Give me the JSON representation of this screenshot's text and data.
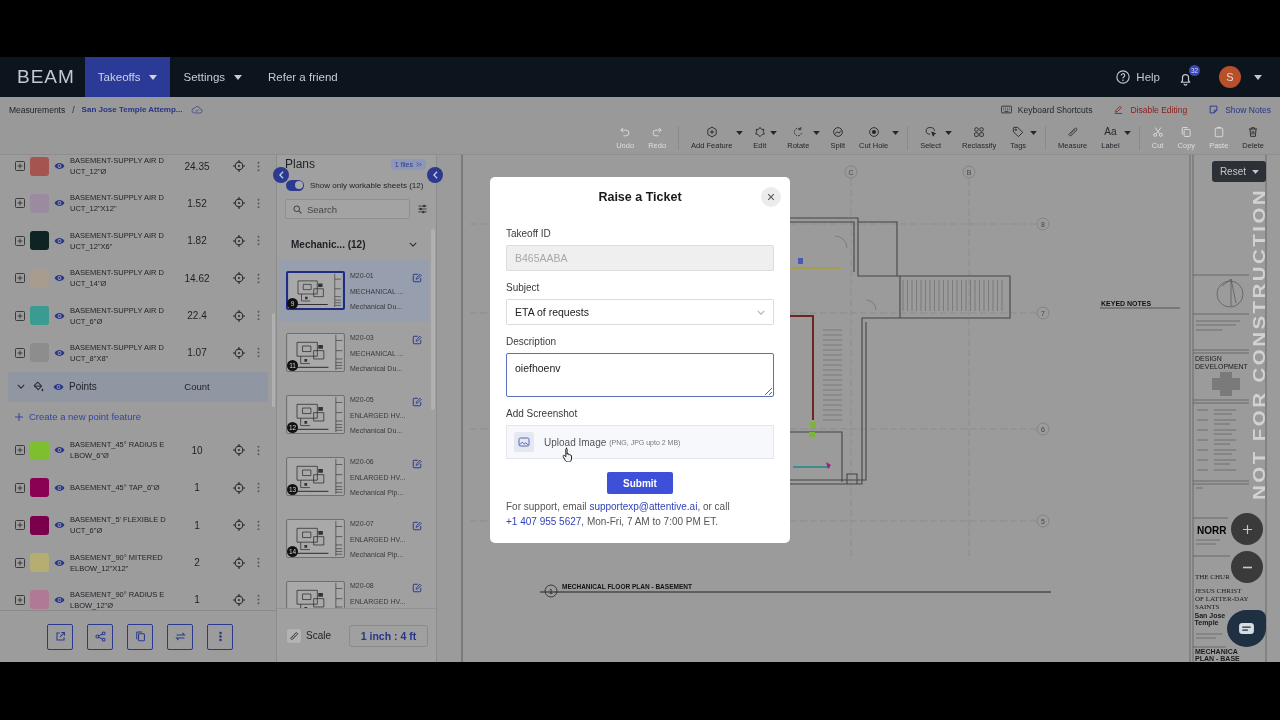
{
  "header": {
    "logo": "BEAM",
    "nav": [
      {
        "label": "Takeoffs",
        "selected": true,
        "menu": true
      },
      {
        "label": "Settings",
        "selected": false,
        "menu": true
      },
      {
        "label": "Refer a friend",
        "selected": false,
        "menu": false
      }
    ],
    "help": "Help",
    "notifications": "32",
    "avatar": "S"
  },
  "breadcrumb": {
    "items": [
      "Measurements",
      "San Jose Temple Attemp..."
    ],
    "separator": "/",
    "actions": [
      {
        "label": "Keyboard Shortcuts",
        "kind": "shortcuts"
      },
      {
        "label": "Disable Editing",
        "kind": "danger"
      },
      {
        "label": "Show Notes",
        "kind": "notes"
      }
    ]
  },
  "toolbar": {
    "groups": [
      {
        "tools": [
          {
            "label": "Undo",
            "disabled": true,
            "menu": false
          },
          {
            "label": "Redo",
            "disabled": true,
            "menu": false
          }
        ]
      },
      {
        "tools": [
          {
            "label": "Add Feature",
            "disabled": false,
            "menu": true
          },
          {
            "label": "Edit",
            "disabled": false,
            "menu": true
          },
          {
            "label": "Rotate",
            "disabled": false,
            "menu": true
          },
          {
            "label": "Split",
            "disabled": false,
            "menu": false
          },
          {
            "label": "Cut Hole",
            "disabled": false,
            "menu": true
          }
        ]
      },
      {
        "tools": [
          {
            "label": "Select",
            "disabled": false,
            "menu": true
          },
          {
            "label": "Reclassify",
            "disabled": false,
            "menu": false
          },
          {
            "label": "Tags",
            "disabled": false,
            "menu": true
          }
        ]
      },
      {
        "tools": [
          {
            "label": "Measure",
            "disabled": false,
            "menu": false
          },
          {
            "label": "Label",
            "glyph": "Aa",
            "disabled": false,
            "menu": true
          }
        ]
      },
      {
        "tools": [
          {
            "label": "Cut",
            "disabled": true,
            "menu": false
          },
          {
            "label": "Copy",
            "disabled": true,
            "menu": false
          },
          {
            "label": "Paste",
            "disabled": true,
            "menu": false
          },
          {
            "label": "Delete",
            "disabled": false,
            "menu": false
          }
        ]
      }
    ]
  },
  "features": {
    "rows": [
      {
        "name": "BASEMENT-SUPPLY AIR DUCT_12\"Ø",
        "value": "24.35",
        "color": "#a65450"
      },
      {
        "name": "BASEMENT-SUPPLY AIR DUCT_12\"X12\"",
        "value": "1.52",
        "color": "#9a8ba0"
      },
      {
        "name": "BASEMENT-SUPPLY AIR DUCT_12\"X6\"",
        "value": "1.82",
        "color": "#0e2424"
      },
      {
        "name": "BASEMENT-SUPPLY AIR DUCT_14\"Ø",
        "value": "14.62",
        "color": "#a89c8e"
      },
      {
        "name": "BASEMENT-SUPPLY AIR DUCT_6\"Ø",
        "value": "22.4",
        "color": "#3a9b92"
      },
      {
        "name": "BASEMENT-SUPPLY AIR DUCT_8\"X8\"",
        "value": "1.07",
        "color": "#8d8d8d"
      }
    ],
    "points": {
      "title": "Points",
      "column": "Count",
      "expanded": true,
      "create": "Create a new point feature",
      "rows": [
        {
          "name": "BASEMENT_45° RADIUS ELBOW_6\"Ø",
          "value": "10",
          "color": "#7dbf2f"
        },
        {
          "name": "BASEMENT_45° TAP_6\"Ø",
          "value": "1",
          "color": "#8a0052"
        },
        {
          "name": "BASEMENT_5' FLEXIBLE DUCT_6\"Ø",
          "value": "1",
          "color": "#7a004c"
        },
        {
          "name": "BASEMENT_90° MITERED ELBOW_12\"X12\"",
          "value": "2",
          "color": "#b5ad72"
        },
        {
          "name": "BASEMENT_90° RADIUS ELBOW_12\"Ø",
          "value": "1",
          "color": "#b07a94"
        }
      ]
    }
  },
  "plans": {
    "title": "Plans",
    "files": "1 files",
    "filter": {
      "label": "Show only workable sheets (12)",
      "on": true
    },
    "search": {
      "placeholder": "Search"
    },
    "group": {
      "label": "Mechanic... (12)",
      "expanded": true
    },
    "sheets": [
      {
        "number": "M20-01",
        "title": "MECHANICAL ...",
        "subtitle": "Mechanical Du...",
        "badge": "9",
        "selected": true
      },
      {
        "number": "M20-03",
        "title": "MECHANICAL ...",
        "subtitle": "Mechanical Du...",
        "badge": "11",
        "selected": false
      },
      {
        "number": "M20-05",
        "title": "ENLARGED HV...",
        "subtitle": "Mechanical Du...",
        "badge": "12",
        "selected": false
      },
      {
        "number": "M20-06",
        "title": "ENLARGED HV...",
        "subtitle": "Mechanical Pip...",
        "badge": "13",
        "selected": false
      },
      {
        "number": "M20-07",
        "title": "ENLARGED HV...",
        "subtitle": "Mechanical Pip...",
        "badge": "14",
        "selected": false
      },
      {
        "number": "M20-08",
        "title": "ENLARGED HV...",
        "selected": false
      }
    ],
    "scale": {
      "label": "Scale",
      "value": "1 inch : 4 ft"
    }
  },
  "drawing": {
    "grid_labels": [
      "C",
      "B",
      "8",
      "7",
      "6",
      "5"
    ],
    "keyed_notes": "KEYED NOTES",
    "plan_number": "1",
    "plan_title": "MECHANICAL FLOOR PLAN - BASEMENT",
    "title_block": [
      "DESIGN DEVELOPMENT",
      "NORR",
      "THE CHUR",
      "JESUS CHRIST",
      "OF LATTER-DAY SAINTS",
      "San Jose Temple",
      "MECHANICA",
      "PLAN - BASE"
    ],
    "stamp": "NOT FOR CONSTRUCTION",
    "reset": "Reset"
  },
  "modal": {
    "title": "Raise a Ticket",
    "fields": [
      {
        "kind": "text",
        "label": "Takeoff ID",
        "value": "B465AABA",
        "disabled": true,
        "focused": false
      },
      {
        "kind": "select",
        "label": "Subject",
        "value": "ETA of requests",
        "disabled": false,
        "focused": false
      },
      {
        "kind": "textarea",
        "label": "Description",
        "value": "oiefhoenv",
        "disabled": false,
        "focused": true
      },
      {
        "kind": "upload",
        "label": "Add Screenshot",
        "value": "Upload Image",
        "hint": "(PNG, JPG upto 2 MB)",
        "disabled": false,
        "focused": false
      }
    ],
    "submit": "Submit",
    "support": {
      "before": "For support, email ",
      "email": "supportexp@attentive.ai",
      "middle": ", or call ",
      "phone": "+1 407 955 5627",
      "after": ", Mon-Fri, 7 AM to 7:00 PM ET."
    }
  }
}
